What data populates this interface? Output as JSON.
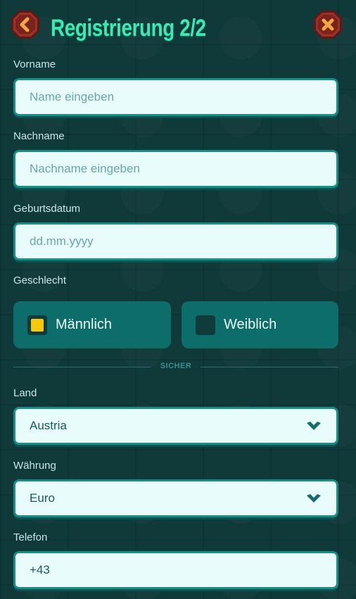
{
  "header": {
    "title": "Registrierung 2/2",
    "back_icon": "back-arrow-icon",
    "close_icon": "close-x-icon"
  },
  "form": {
    "first_name": {
      "label": "Vorname",
      "placeholder": "Name eingeben",
      "value": ""
    },
    "last_name": {
      "label": "Nachname",
      "placeholder": "Nachname eingeben",
      "value": ""
    },
    "birthdate": {
      "label": "Geburtsdatum",
      "placeholder": "dd.mm.yyyy",
      "value": ""
    },
    "gender": {
      "label": "Geschlecht",
      "options": [
        {
          "label": "Männlich",
          "checked": true
        },
        {
          "label": "Weiblich",
          "checked": false
        }
      ]
    },
    "divider_text": "SICHER",
    "country": {
      "label": "Land",
      "value": "Austria"
    },
    "currency": {
      "label": "Währung",
      "value": "Euro"
    },
    "phone": {
      "label": "Telefon",
      "value": "+43"
    }
  },
  "colors": {
    "title": "#3ee8b4",
    "accent_teal": "#1a8e86",
    "checkbox_checked": "#f6c90e",
    "hex_button_fill": "#8b2a22",
    "hex_button_icon": "#f3a742"
  }
}
